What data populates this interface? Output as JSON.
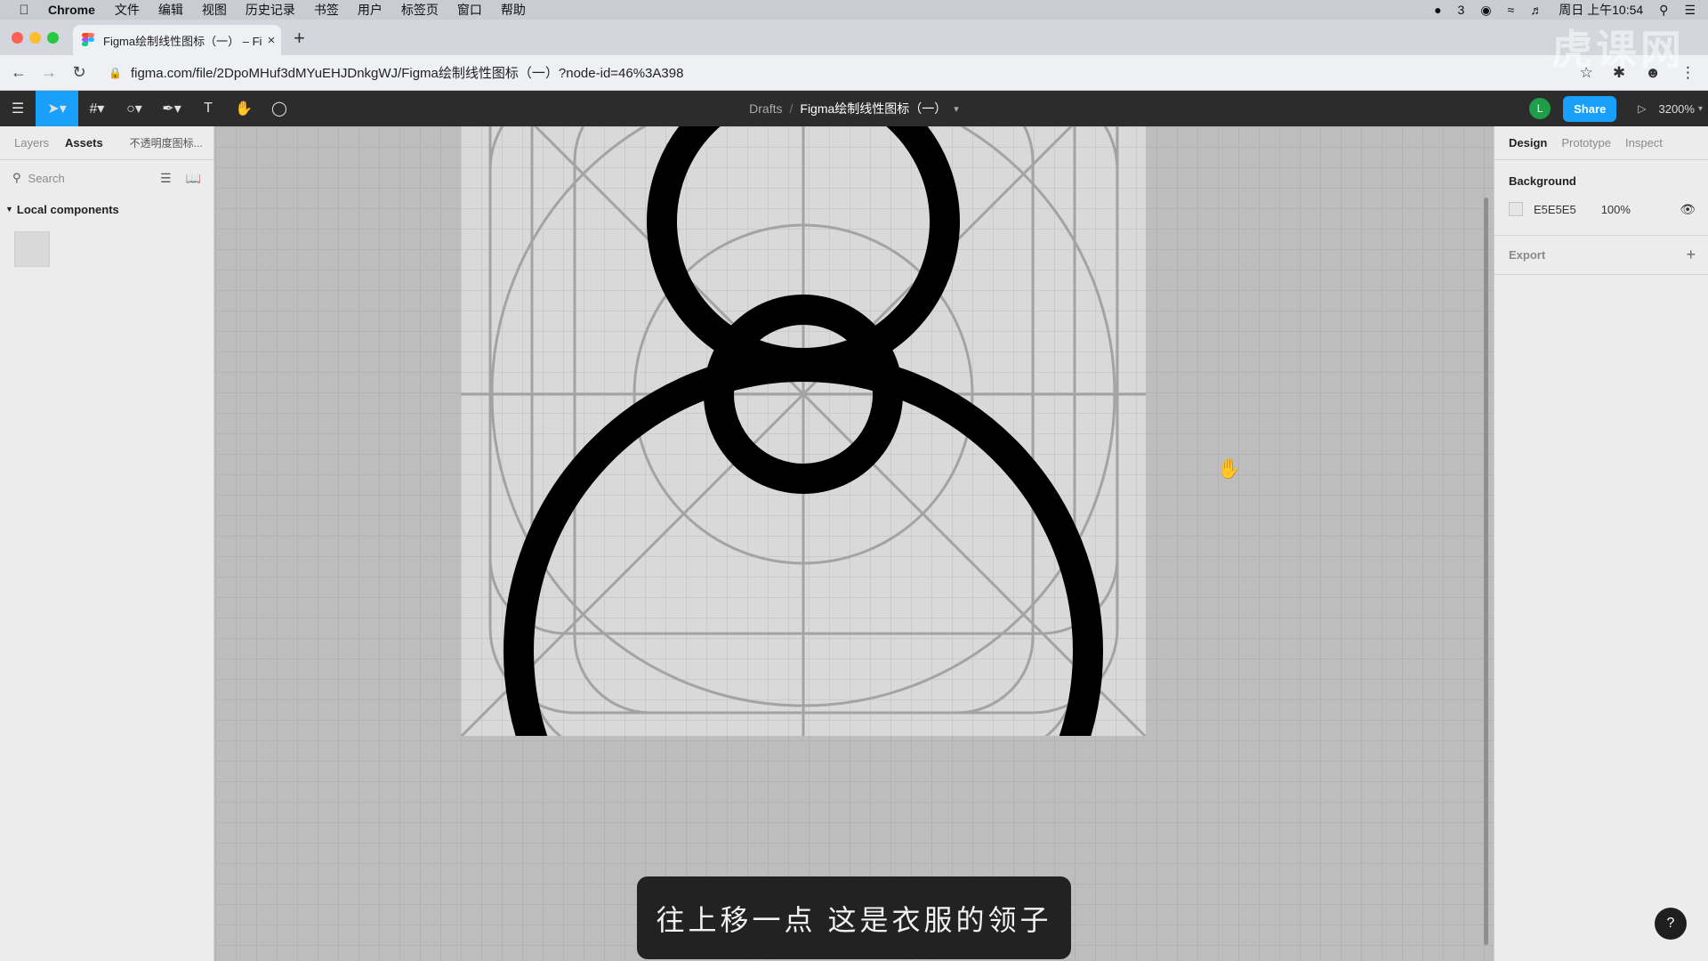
{
  "menubar": {
    "apple_icon": "apple-logo",
    "app_name": "Chrome",
    "items": [
      "文件",
      "编辑",
      "视图",
      "历史记录",
      "书签",
      "用户",
      "标签页",
      "窗口",
      "帮助"
    ],
    "wechat_count": "3",
    "clock": "周日 上午10:54"
  },
  "browser": {
    "tab_title": "Figma绘制线性图标（一） – Fig",
    "tab_close": "×",
    "new_tab": "+",
    "url": "figma.com/file/2DpoMHuf3dMYuEHJDnkgWJ/Figma绘制线性图标（一）?node-id=46%3A398"
  },
  "figma_toolbar": {
    "breadcrumb_root": "Drafts",
    "breadcrumb_sep": "/",
    "file_name": "Figma绘制线性图标（一）",
    "avatar_letter": "L",
    "share_label": "Share",
    "zoom": "3200%"
  },
  "left_panel": {
    "tab_layers": "Layers",
    "tab_assets": "Assets",
    "library_name": "不透明度图标...",
    "search_placeholder": "Search",
    "section_title": "Local components"
  },
  "right_panel": {
    "tab_design": "Design",
    "tab_prototype": "Prototype",
    "tab_inspect": "Inspect",
    "background_title": "Background",
    "bg_hex": "E5E5E5",
    "bg_opacity": "100%",
    "export_title": "Export"
  },
  "subtitle": "往上移一点 这是衣服的领子",
  "watermark": "虎课网",
  "help": "?",
  "colors": {
    "figma_blue": "#18a0fb",
    "toolbar_bg": "#2c2c2c",
    "avatar_green": "#1e9e48",
    "close_red": "#fe5f57",
    "min_yellow": "#febc2e",
    "max_green": "#28c840"
  }
}
